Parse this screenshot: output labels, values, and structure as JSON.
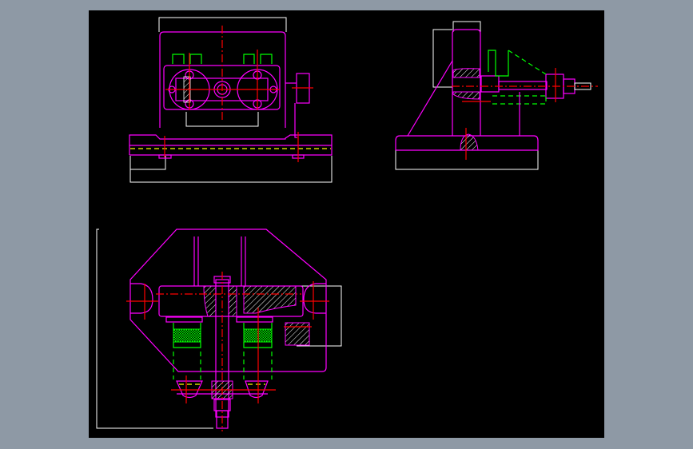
{
  "viewer": {
    "background_color": "#8e99a5",
    "canvas_color": "#000000"
  },
  "drawing": {
    "views": [
      "front-view",
      "side-view",
      "top-view"
    ],
    "colors": {
      "outline": "#ff00ff",
      "dimension": "#ffffff",
      "centerline": "#ff0000",
      "hidden": "#00ff00",
      "hidden_alt": "#ffff00"
    }
  }
}
